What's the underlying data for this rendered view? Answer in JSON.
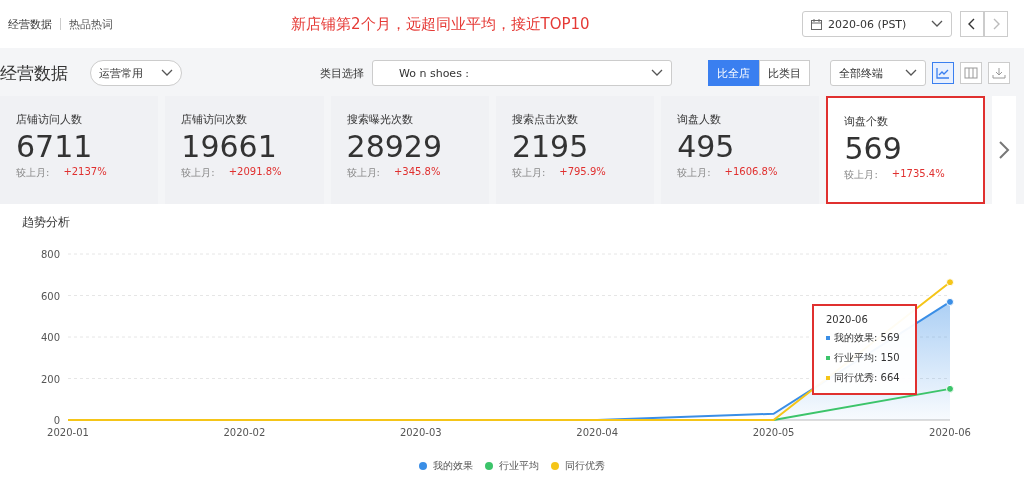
{
  "top_tabs": [
    {
      "label": "经营数据",
      "selected": true
    },
    {
      "label": "热品热词",
      "selected": false
    }
  ],
  "headline": "新店铺第2个月，远超同业平均，接近TOP10",
  "date_select": {
    "value": "2020-06 (PST)"
  },
  "section_title": "经营数据",
  "preset_select": {
    "value": "运营常用"
  },
  "category": {
    "label": "类目选择",
    "value": "Wo    n shoes :"
  },
  "compare_toggle": [
    {
      "label": "比全店",
      "selected": true
    },
    {
      "label": "比类目",
      "selected": false
    }
  ],
  "terminal_select": {
    "value": "全部终端"
  },
  "view_buttons": [
    {
      "kind": "chart",
      "selected": true
    },
    {
      "kind": "table",
      "selected": false
    },
    {
      "kind": "download",
      "selected": false
    }
  ],
  "metrics": [
    {
      "name": "店铺访问人数",
      "value": "6711",
      "compare_label": "较上月:",
      "change": "+2137%",
      "highlighted": false
    },
    {
      "name": "店铺访问次数",
      "value": "19661",
      "compare_label": "较上月:",
      "change": "+2091.8%",
      "highlighted": false
    },
    {
      "name": "搜索曝光次数",
      "value": "28929",
      "compare_label": "较上月:",
      "change": "+345.8%",
      "highlighted": false
    },
    {
      "name": "搜索点击次数",
      "value": "2195",
      "compare_label": "较上月:",
      "change": "+795.9%",
      "highlighted": false
    },
    {
      "name": "询盘人数",
      "value": "495",
      "compare_label": "较上月:",
      "change": "+1606.8%",
      "highlighted": false
    },
    {
      "name": "询盘个数",
      "value": "569",
      "compare_label": "较上月:",
      "change": "+1735.4%",
      "highlighted": true
    }
  ],
  "trend": {
    "title": "趋势分析",
    "chart_data": {
      "type": "line",
      "grid": true,
      "categories": [
        "2020-01",
        "2020-02",
        "2020-03",
        "2020-04",
        "2020-05",
        "2020-06"
      ],
      "ylim": [
        0,
        800
      ],
      "yticks": [
        0,
        200,
        400,
        600,
        800
      ],
      "series": [
        {
          "name": "我的效果",
          "color": "#3a8ee6",
          "values": [
            null,
            null,
            0,
            0,
            30,
            569
          ]
        },
        {
          "name": "行业平均",
          "color": "#3cc46a",
          "values": [
            null,
            null,
            null,
            null,
            0,
            150
          ]
        },
        {
          "name": "同行优秀",
          "color": "#f5c518",
          "values": [
            0,
            0,
            0,
            0,
            0,
            664
          ]
        }
      ]
    },
    "tooltip": {
      "title": "2020-06",
      "highlighted": true,
      "rows": [
        {
          "label": "我的效果: 569",
          "color": "#3a8ee6"
        },
        {
          "label": "行业平均: 150",
          "color": "#3cc46a"
        },
        {
          "label": "同行优秀: 664",
          "color": "#f5c518"
        }
      ]
    }
  }
}
